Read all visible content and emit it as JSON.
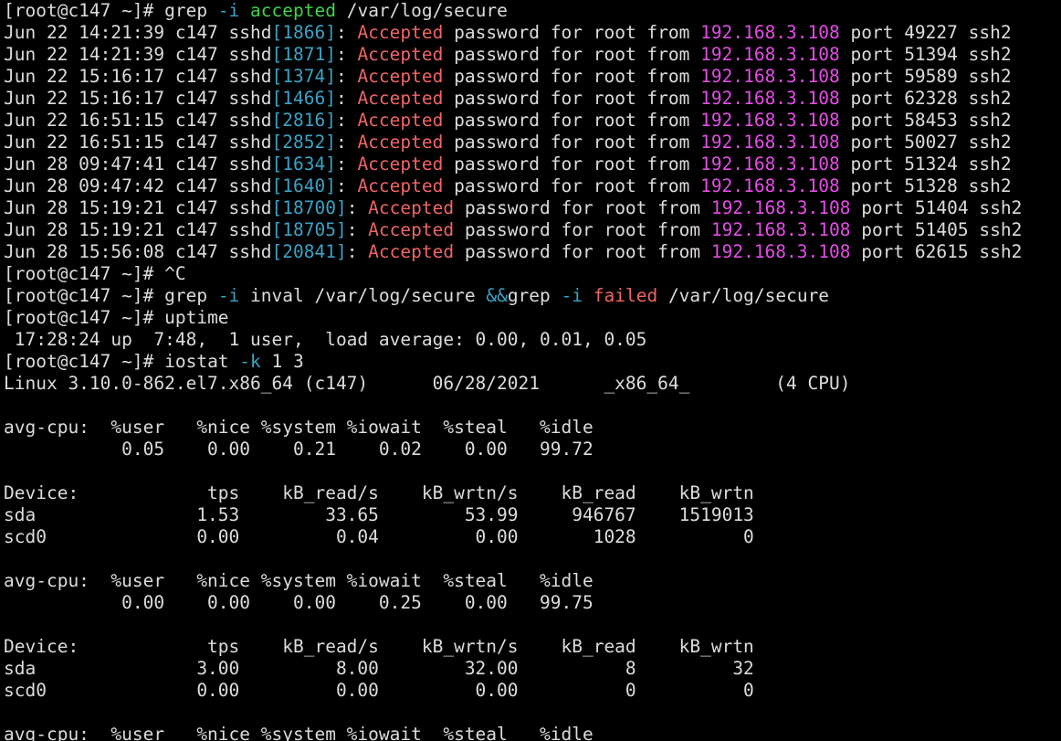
{
  "colors": {
    "background": "#000000",
    "text": "#dcdcdc",
    "option_flag": "#3aa3c6",
    "grep_match": "#ef6565",
    "ip_address": "#e64ce8",
    "grep_pattern_accepted": "#3fd34e"
  },
  "prompt": "[root@c147 ~]# ",
  "cmd1": {
    "bin": "grep ",
    "flag": "-i",
    "sp": " ",
    "pattern": "accepted",
    "arg": " /var/log/secure"
  },
  "log_lines": [
    {
      "prefix": "Jun 22 14:21:39 c147 sshd",
      "pid": "[1866]",
      "colon": ": ",
      "match": "Accepted",
      "mid": " password for root from ",
      "ip": "192.168.3.108",
      "tail": " port 49227 ssh2"
    },
    {
      "prefix": "Jun 22 14:21:39 c147 sshd",
      "pid": "[1871]",
      "colon": ": ",
      "match": "Accepted",
      "mid": " password for root from ",
      "ip": "192.168.3.108",
      "tail": " port 51394 ssh2"
    },
    {
      "prefix": "Jun 22 15:16:17 c147 sshd",
      "pid": "[1374]",
      "colon": ": ",
      "match": "Accepted",
      "mid": " password for root from ",
      "ip": "192.168.3.108",
      "tail": " port 59589 ssh2"
    },
    {
      "prefix": "Jun 22 15:16:17 c147 sshd",
      "pid": "[1466]",
      "colon": ": ",
      "match": "Accepted",
      "mid": " password for root from ",
      "ip": "192.168.3.108",
      "tail": " port 62328 ssh2"
    },
    {
      "prefix": "Jun 22 16:51:15 c147 sshd",
      "pid": "[2816]",
      "colon": ": ",
      "match": "Accepted",
      "mid": " password for root from ",
      "ip": "192.168.3.108",
      "tail": " port 58453 ssh2"
    },
    {
      "prefix": "Jun 22 16:51:15 c147 sshd",
      "pid": "[2852]",
      "colon": ": ",
      "match": "Accepted",
      "mid": " password for root from ",
      "ip": "192.168.3.108",
      "tail": " port 50027 ssh2"
    },
    {
      "prefix": "Jun 28 09:47:41 c147 sshd",
      "pid": "[1634]",
      "colon": ": ",
      "match": "Accepted",
      "mid": " password for root from ",
      "ip": "192.168.3.108",
      "tail": " port 51324 ssh2"
    },
    {
      "prefix": "Jun 28 09:47:42 c147 sshd",
      "pid": "[1640]",
      "colon": ": ",
      "match": "Accepted",
      "mid": " password for root from ",
      "ip": "192.168.3.108",
      "tail": " port 51328 ssh2"
    },
    {
      "prefix": "Jun 28 15:19:21 c147 sshd",
      "pid": "[18700]",
      "colon": ": ",
      "match": "Accepted",
      "mid": " password for root from ",
      "ip": "192.168.3.108",
      "tail": " port 51404 ssh2"
    },
    {
      "prefix": "Jun 28 15:19:21 c147 sshd",
      "pid": "[18705]",
      "colon": ": ",
      "match": "Accepted",
      "mid": " password for root from ",
      "ip": "192.168.3.108",
      "tail": " port 51405 ssh2"
    },
    {
      "prefix": "Jun 28 15:56:08 c147 sshd",
      "pid": "[20841]",
      "colon": ": ",
      "match": "Accepted",
      "mid": " password for root from ",
      "ip": "192.168.3.108",
      "tail": " port 62615 ssh2"
    }
  ],
  "cmd2": "^C",
  "cmd3": {
    "bin1": "grep ",
    "flag1": "-i",
    "arg1": " inval /var/log/secure ",
    "op": "&&",
    "bin2": "grep ",
    "flag2": "-i",
    "sp": " ",
    "pattern2": "failed",
    "arg2": " /var/log/secure"
  },
  "cmd4": "uptime",
  "uptime_output": " 17:28:24 up  7:48,  1 user,  load average: 0.00, 0.01, 0.05",
  "cmd5": {
    "bin": "iostat ",
    "flag": "-k",
    "args": " 1 3"
  },
  "iostat": {
    "sysinfo": "Linux 3.10.0-862.el7.x86_64 (c147)      06/28/2021      _x86_64_        (4 CPU)",
    "blocks": [
      {
        "cpu_header": "avg-cpu:  %user   %nice %system %iowait  %steal   %idle",
        "cpu_values": "           0.05    0.00    0.21    0.02    0.00   99.72",
        "dev_header": "Device:            tps    kB_read/s    kB_wrtn/s    kB_read    kB_wrtn",
        "dev_rows": [
          "sda               1.53        33.65        53.99     946767    1519013",
          "scd0              0.00         0.04         0.00       1028          0"
        ]
      },
      {
        "cpu_header": "avg-cpu:  %user   %nice %system %iowait  %steal   %idle",
        "cpu_values": "           0.00    0.00    0.00    0.25    0.00   99.75",
        "dev_header": "Device:            tps    kB_read/s    kB_wrtn/s    kB_read    kB_wrtn",
        "dev_rows": [
          "sda               3.00         8.00        32.00          8         32",
          "scd0              0.00         0.00         0.00          0          0"
        ]
      }
    ],
    "partial_cpu_header": "avg-cpu:  %user   %nice %system %iowait  %steal   %idle"
  }
}
